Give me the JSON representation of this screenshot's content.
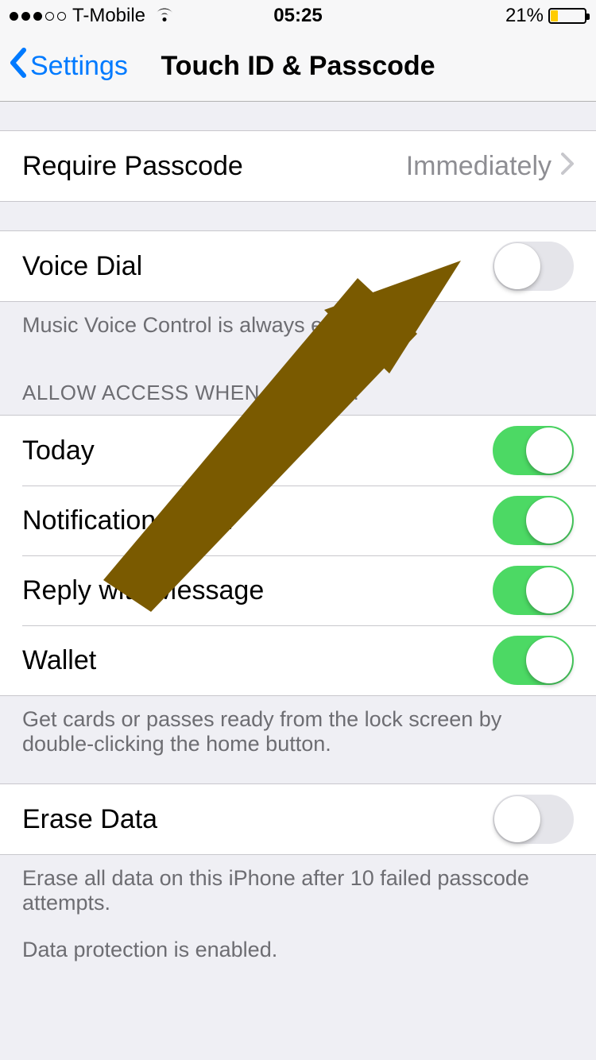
{
  "status": {
    "carrier": "T-Mobile",
    "time": "05:25",
    "battery_pct": "21%"
  },
  "nav": {
    "back_label": "Settings",
    "title": "Touch ID & Passcode"
  },
  "require_passcode": {
    "label": "Require Passcode",
    "value": "Immediately"
  },
  "voice_dial": {
    "label": "Voice Dial",
    "on": false,
    "footer": "Music Voice Control is always enabled."
  },
  "allow_access": {
    "header": "ALLOW ACCESS WHEN LOCKED:",
    "items": [
      {
        "label": "Today",
        "on": true
      },
      {
        "label": "Notifications View",
        "on": true
      },
      {
        "label": "Reply with Message",
        "on": true
      },
      {
        "label": "Wallet",
        "on": true
      }
    ],
    "footer": "Get cards or passes ready from the lock screen by double-clicking the home button."
  },
  "erase": {
    "label": "Erase Data",
    "on": false,
    "footer1": "Erase all data on this iPhone after 10 failed passcode attempts.",
    "footer2": "Data protection is enabled."
  },
  "annotation": {
    "arrow_color": "#7a5a00"
  }
}
